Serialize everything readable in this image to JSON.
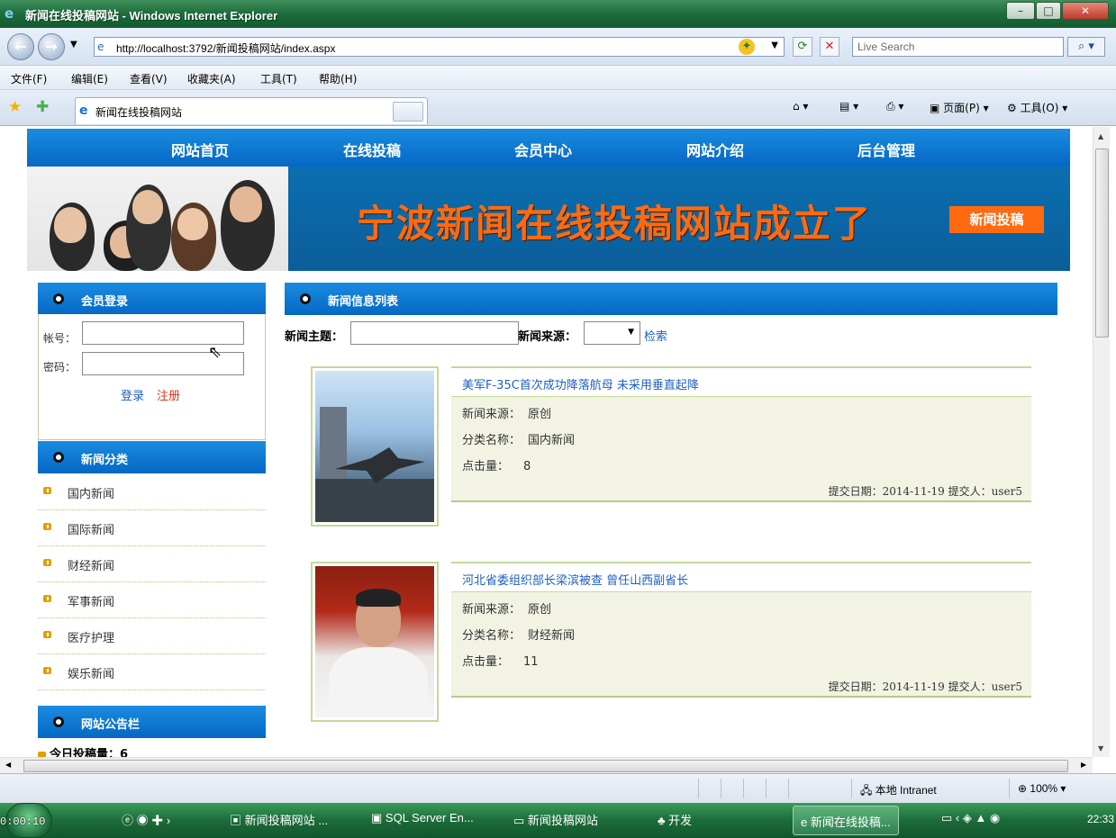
{
  "window": {
    "title": "新闻在线投稿网站 - Windows Internet Explorer"
  },
  "browser": {
    "url": "http://localhost:3792/新闻投稿网站/index.aspx",
    "search_placeholder": "Live Search",
    "menu": [
      "文件(F)",
      "编辑(E)",
      "查看(V)",
      "收藏夹(A)",
      "工具(T)",
      "帮助(H)"
    ],
    "tab_title": "新闻在线投稿网站",
    "command_page": "页面(P)",
    "command_tools": "工具(O)"
  },
  "site": {
    "nav": [
      "网站首页",
      "在线投稿",
      "会员中心",
      "网站介绍",
      "后台管理"
    ],
    "banner_headline": "宁波新闻在线投稿网站成立了",
    "banner_button": "新闻投稿"
  },
  "login": {
    "title": "会员登录",
    "account_label": "帐号：",
    "password_label": "密码：",
    "login_link": "登录",
    "register_link": "注册"
  },
  "categories": {
    "title": "新闻分类",
    "items": [
      "国内新闻",
      "国际新闻",
      "财经新闻",
      "军事新闻",
      "医疗护理",
      "娱乐新闻"
    ]
  },
  "notice": {
    "title": "网站公告栏",
    "line": "今日投稿量：6"
  },
  "news": {
    "title": "新闻信息列表",
    "filter_topic_label": "新闻主题：",
    "filter_source_label": "新闻来源：",
    "search_link": "检索",
    "items": [
      {
        "title": "美军F-35C首次成功降落航母 未采用垂直起降",
        "source_label": "新闻来源：",
        "source": "原创",
        "category_label": "分类名称：",
        "category": "国内新闻",
        "hits_label": "点击量：",
        "hits": "8",
        "footer": "提交日期：2014-11-19 提交人：user5"
      },
      {
        "title": "河北省委组织部长梁滨被查 曾任山西副省长",
        "source_label": "新闻来源：",
        "source": "原创",
        "category_label": "分类名称：",
        "category": "财经新闻",
        "hits_label": "点击量：",
        "hits": "11",
        "footer": "提交日期：2014-11-19 提交人：user5"
      }
    ]
  },
  "statusbar": {
    "zone": "本地 Intranet",
    "zoom": "100%"
  },
  "taskbar": {
    "timer": "0:00:10",
    "tasks": [
      "新闻投稿网站 ...",
      "SQL Server En...",
      "新闻投稿网站",
      "开发",
      "新闻在线投稿..."
    ],
    "clock": "22:33"
  }
}
